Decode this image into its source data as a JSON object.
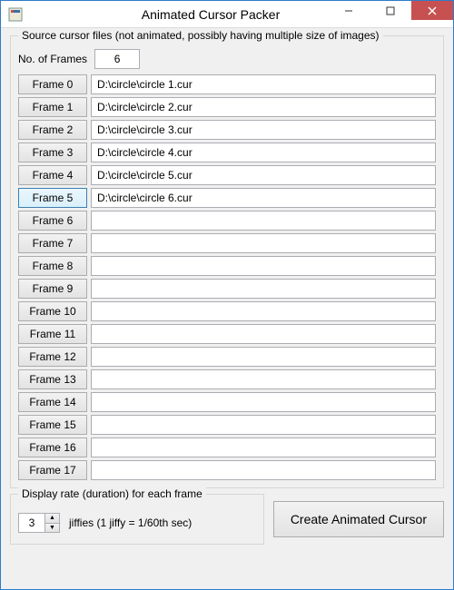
{
  "window": {
    "title": "Animated Cursor Packer"
  },
  "source_group": {
    "label": "Source cursor files (not animated, possibly having multiple size of images)",
    "num_frames_label": "No. of Frames",
    "num_frames_value": "6"
  },
  "frames": [
    {
      "label": "Frame 0",
      "path": "D:\\circle\\circle 1.cur",
      "selected": false
    },
    {
      "label": "Frame 1",
      "path": "D:\\circle\\circle 2.cur",
      "selected": false
    },
    {
      "label": "Frame 2",
      "path": "D:\\circle\\circle 3.cur",
      "selected": false
    },
    {
      "label": "Frame 3",
      "path": "D:\\circle\\circle 4.cur",
      "selected": false
    },
    {
      "label": "Frame 4",
      "path": "D:\\circle\\circle 5.cur",
      "selected": false
    },
    {
      "label": "Frame 5",
      "path": "D:\\circle\\circle 6.cur",
      "selected": true
    },
    {
      "label": "Frame 6",
      "path": "",
      "selected": false
    },
    {
      "label": "Frame 7",
      "path": "",
      "selected": false
    },
    {
      "label": "Frame 8",
      "path": "",
      "selected": false
    },
    {
      "label": "Frame 9",
      "path": "",
      "selected": false
    },
    {
      "label": "Frame 10",
      "path": "",
      "selected": false
    },
    {
      "label": "Frame 11",
      "path": "",
      "selected": false
    },
    {
      "label": "Frame 12",
      "path": "",
      "selected": false
    },
    {
      "label": "Frame 13",
      "path": "",
      "selected": false
    },
    {
      "label": "Frame 14",
      "path": "",
      "selected": false
    },
    {
      "label": "Frame 15",
      "path": "",
      "selected": false
    },
    {
      "label": "Frame 16",
      "path": "",
      "selected": false
    },
    {
      "label": "Frame 17",
      "path": "",
      "selected": false
    }
  ],
  "rate_group": {
    "label": "Display rate (duration) for each frame",
    "value": "3",
    "unit_text": "jiffies (1 jiffy = 1/60th sec)"
  },
  "create_button": "Create Animated Cursor"
}
